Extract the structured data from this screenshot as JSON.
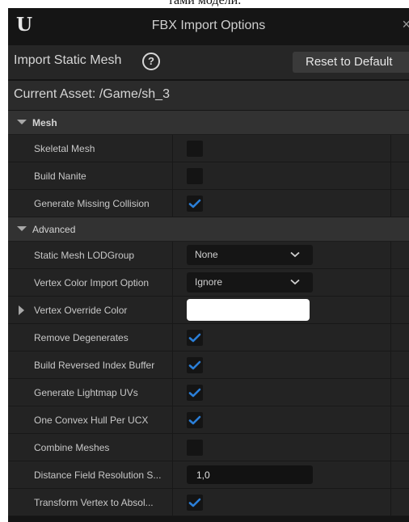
{
  "caption": "тами модели.",
  "window": {
    "logo": "U",
    "title": "FBX Import Options",
    "close": "×"
  },
  "options_bar": {
    "label": "Import Static Mesh",
    "help": "?",
    "reset_label": "Reset to Default"
  },
  "asset": {
    "label": "Current Asset:  /Game/sh_3"
  },
  "sections": {
    "mesh": "Mesh",
    "advanced": "Advanced"
  },
  "mesh_rows": [
    {
      "label": "Skeletal Mesh",
      "checked": false
    },
    {
      "label": "Build Nanite",
      "checked": false
    },
    {
      "label": "Generate Missing Collision",
      "checked": true
    }
  ],
  "advanced_rows": {
    "lod_group": {
      "label": "Static Mesh LODGroup",
      "value": "None"
    },
    "vertex_color_import": {
      "label": "Vertex Color Import Option",
      "value": "Ignore"
    },
    "vertex_override_color": {
      "label": "Vertex Override Color",
      "color": "#ffffff"
    },
    "remove_degenerates": {
      "label": "Remove Degenerates",
      "checked": true
    },
    "build_reversed_index": {
      "label": "Build Reversed Index Buffer",
      "checked": true
    },
    "generate_lightmap_uvs": {
      "label": "Generate Lightmap UVs",
      "checked": true
    },
    "one_convex_hull": {
      "label": "One Convex Hull Per UCX",
      "checked": true
    },
    "combine_meshes": {
      "label": "Combine Meshes",
      "checked": false
    },
    "distance_field": {
      "label": "Distance Field Resolution S...",
      "value": "1,0"
    },
    "transform_vertex": {
      "label": "Transform Vertex to Absol...",
      "checked": true
    }
  },
  "colors": {
    "accent": "#2b7fd8",
    "window_bg": "#151515",
    "row_bg": "#232323"
  }
}
